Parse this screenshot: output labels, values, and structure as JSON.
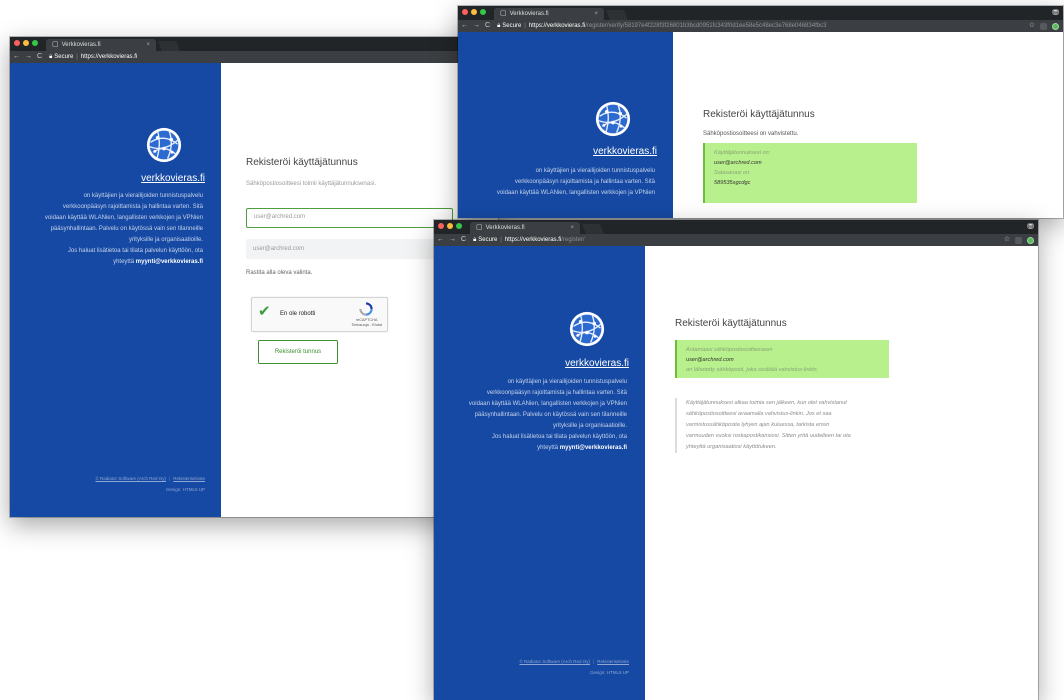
{
  "tab_title": "Verkkovieras.fi",
  "tab_close": "×",
  "nav": {
    "back": "←",
    "forward": "→",
    "reload": "C"
  },
  "secure_label": "Secure",
  "url_host": "https://verkkovieras.fi",
  "windows": {
    "w1": {
      "url_path": ""
    },
    "w2": {
      "url_path": "/register/verify/58197e4f228f3f26801b3bcd0951fc343f0d1ee58e5c48ec3e768e046834fbc3"
    },
    "w3": {
      "url_path": "/register/"
    }
  },
  "sidebar": {
    "brand": "verkkovieras.fi",
    "description_lines": [
      "on käyttäjien ja vierailijoiden tunnistuspalvelu",
      "verkkoonpääsyn rajoittamista ja hallintaa varten. Sitä",
      "voidaan käyttää WLANien, langallisten verkkojen ja VPNien",
      "pääsynhallintaan. Palvelu on käytössä vain sen tilanneille",
      "yrityksille ja organisaatioille.",
      "Jos haluat lisätietoa tai tilata palvelun käyttöön, ota"
    ],
    "contact_prefix": "yhteyttä",
    "contact_email": "myynti@verkkovieras.fi",
    "footer_company": "© Radiator Software (Arch Red Oy)",
    "footer_sep": "|",
    "footer_privacy": "Rekisteriseloste",
    "footer_design": "Design: HTML5 UP"
  },
  "register": {
    "title": "Rekisteröi käyttäjätunnus",
    "subtitle": "Sähköpostiosoitteesi toimii käyttäjätunnuksenasi.",
    "email_value": "user@archred.com",
    "email_confirm_value": "user@archred.com",
    "instruction": "Rastita alla oleva valinta.",
    "recaptcha_label": "En ole robotti",
    "recaptcha_brand": "reCAPTCHA",
    "recaptcha_terms": "Tietosuoja - Ehdot",
    "submit_label": "Rekisteröi tunnus"
  },
  "verify": {
    "title": "Rekisteröi käyttäjätunnus",
    "subtitle": "Sähköpostiosoitteesi on vahvistettu.",
    "username_label": "Käyttäjätunnuksesi on:",
    "username": "user@archred.com",
    "password_label": "Salasanasi on:",
    "password": "589535sgcdgc"
  },
  "sent": {
    "title": "Rekisteröi käyttäjätunnus",
    "line1": "Antamaasi sähköpostiosoitteeseen",
    "email": "user@archred.com",
    "line3": "on lähetetty sähköposti, joka sisältää vahvistus-linkin.",
    "note_lines": [
      "Käyttäjätunnuksesi alkaa toimia sen jälkeen, kun olet vahvistanut",
      "sähköpostiosoitteesi avaamalla vahvistus-linkin. Jos et saa",
      "varmistussähköpostia lyhyen ajan kuluessa, tarkista ensin",
      "varmuuden vuoksi roskapostikansiosi. Sitten yritä uudelleen tai ota",
      "yhteyttä organisaatiosi käyttötukeen."
    ]
  },
  "colors": {
    "sidebar": "#1549a3",
    "accent_green": "#3d8f2e",
    "success_box": "#b7f08c"
  },
  "icons": {
    "globe": "globe-icon",
    "lock": "lock-icon",
    "star": "star-icon"
  }
}
